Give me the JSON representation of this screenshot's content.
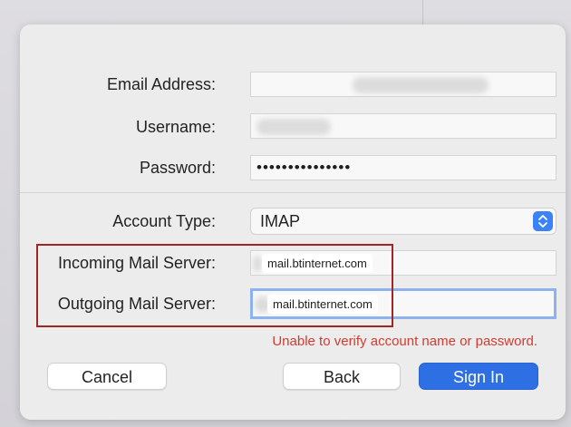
{
  "form": {
    "email_label": "Email Address:",
    "username_label": "Username:",
    "password_label": "Password:",
    "password_value": "•••••••••••••••",
    "account_type_label": "Account Type:",
    "account_type_value": "IMAP",
    "incoming_label": "Incoming Mail Server:",
    "incoming_value": "mail.btinternet.com",
    "outgoing_label": "Outgoing Mail Server:",
    "outgoing_value": "mail.btinternet.com"
  },
  "error_text": "Unable to verify account name or password.",
  "buttons": {
    "cancel": "Cancel",
    "back": "Back",
    "sign_in": "Sign In"
  },
  "colors": {
    "accent": "#2f6fe4",
    "error": "#d23b30",
    "highlight": "#a02626"
  }
}
